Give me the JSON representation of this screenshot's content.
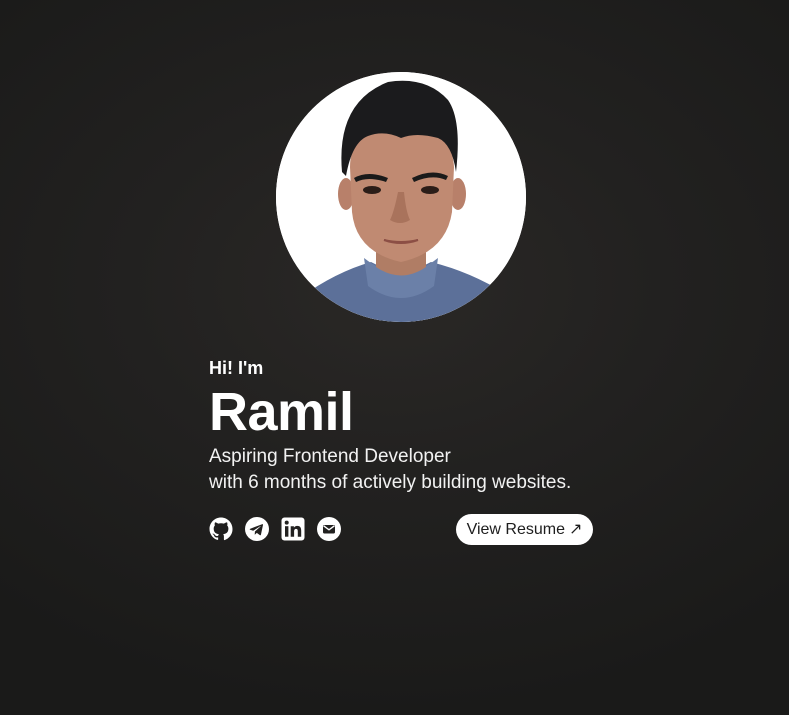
{
  "profile": {
    "photo_description": "profile-photo",
    "greeting": "Hi! I'm",
    "name": "Ramil",
    "tagline_line1": "Aspiring Frontend Developer",
    "tagline_line2": "with 6 months of actively building websites."
  },
  "socials": [
    {
      "icon": "github-icon"
    },
    {
      "icon": "telegram-icon"
    },
    {
      "icon": "linkedin-icon"
    },
    {
      "icon": "mail-icon"
    }
  ],
  "resume_button": {
    "label": "View Resume",
    "arrow": "↗"
  },
  "colors": {
    "background": "#222120",
    "text": "#ffffff",
    "button_bg": "#ffffff",
    "button_text": "#1d1d1d"
  }
}
